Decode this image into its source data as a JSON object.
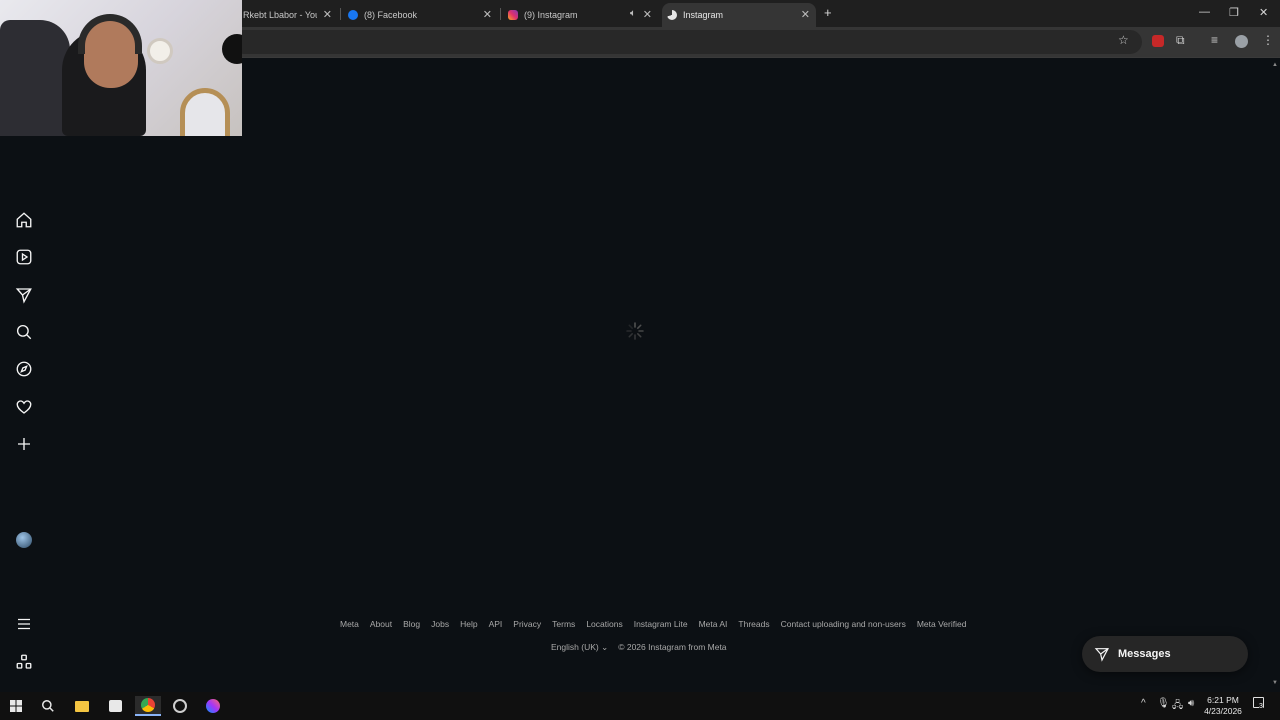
{
  "browser": {
    "tabs": [
      {
        "title": "Rkebt Lbabor - YouT",
        "icon": "youtube-icon"
      },
      {
        "title": "(8) Facebook",
        "icon": "facebook-icon"
      },
      {
        "title": "(9) Instagram",
        "icon": "instagram-icon"
      },
      {
        "title": "Instagram",
        "icon": "instagram-icon",
        "active": true
      }
    ]
  },
  "footer": {
    "links": [
      "Meta",
      "About",
      "Blog",
      "Jobs",
      "Help",
      "API",
      "Privacy",
      "Terms",
      "Locations",
      "Instagram Lite",
      "Meta AI",
      "Threads",
      "Contact uploading and non-users",
      "Meta Verified"
    ],
    "language": "English (UK)",
    "copyright": "© 2026 Instagram from Meta"
  },
  "messages": {
    "label": "Messages"
  },
  "taskbar": {
    "time": "6:21 PM",
    "date": "4/23/2026",
    "notifications": "3"
  },
  "colors": {
    "background": "#0c1014",
    "chrome": "#1f1f1f",
    "text_secondary": "#a8a8a8"
  }
}
